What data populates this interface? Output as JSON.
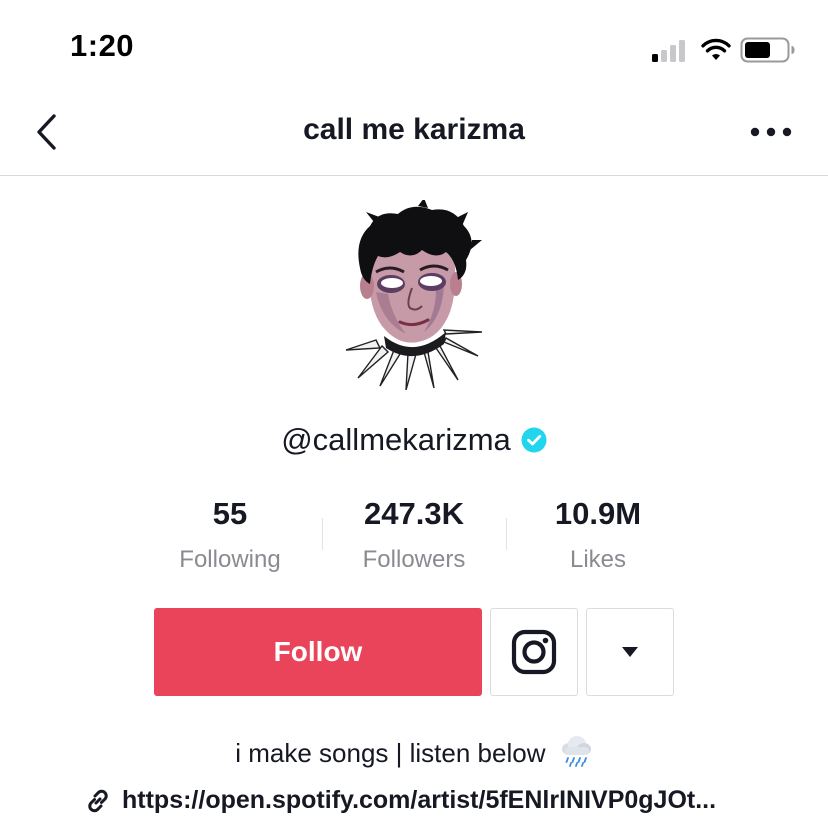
{
  "status_bar": {
    "time": "1:20"
  },
  "nav": {
    "title": "call me karizma",
    "back_icon": "chevron-left-icon",
    "more_icon": "more-horizontal-icon"
  },
  "profile": {
    "username": "@callmekarizma",
    "verified": true
  },
  "stats": [
    {
      "value": "55",
      "label": "Following"
    },
    {
      "value": "247.3K",
      "label": "Followers"
    },
    {
      "value": "10.9M",
      "label": "Likes"
    }
  ],
  "actions": {
    "follow_label": "Follow",
    "instagram_icon": "instagram-icon",
    "dropdown_icon": "caret-down-icon"
  },
  "bio": {
    "text": "i make songs | listen below",
    "emoji": "rain-cloud-icon",
    "link": "https://open.spotify.com/artist/5fENlrINIVP0gJOt..."
  },
  "colors": {
    "follow_button": "#ea445a",
    "verified_badge": "#20d5ec",
    "text_primary": "#161823",
    "text_secondary": "#8a8b91"
  }
}
